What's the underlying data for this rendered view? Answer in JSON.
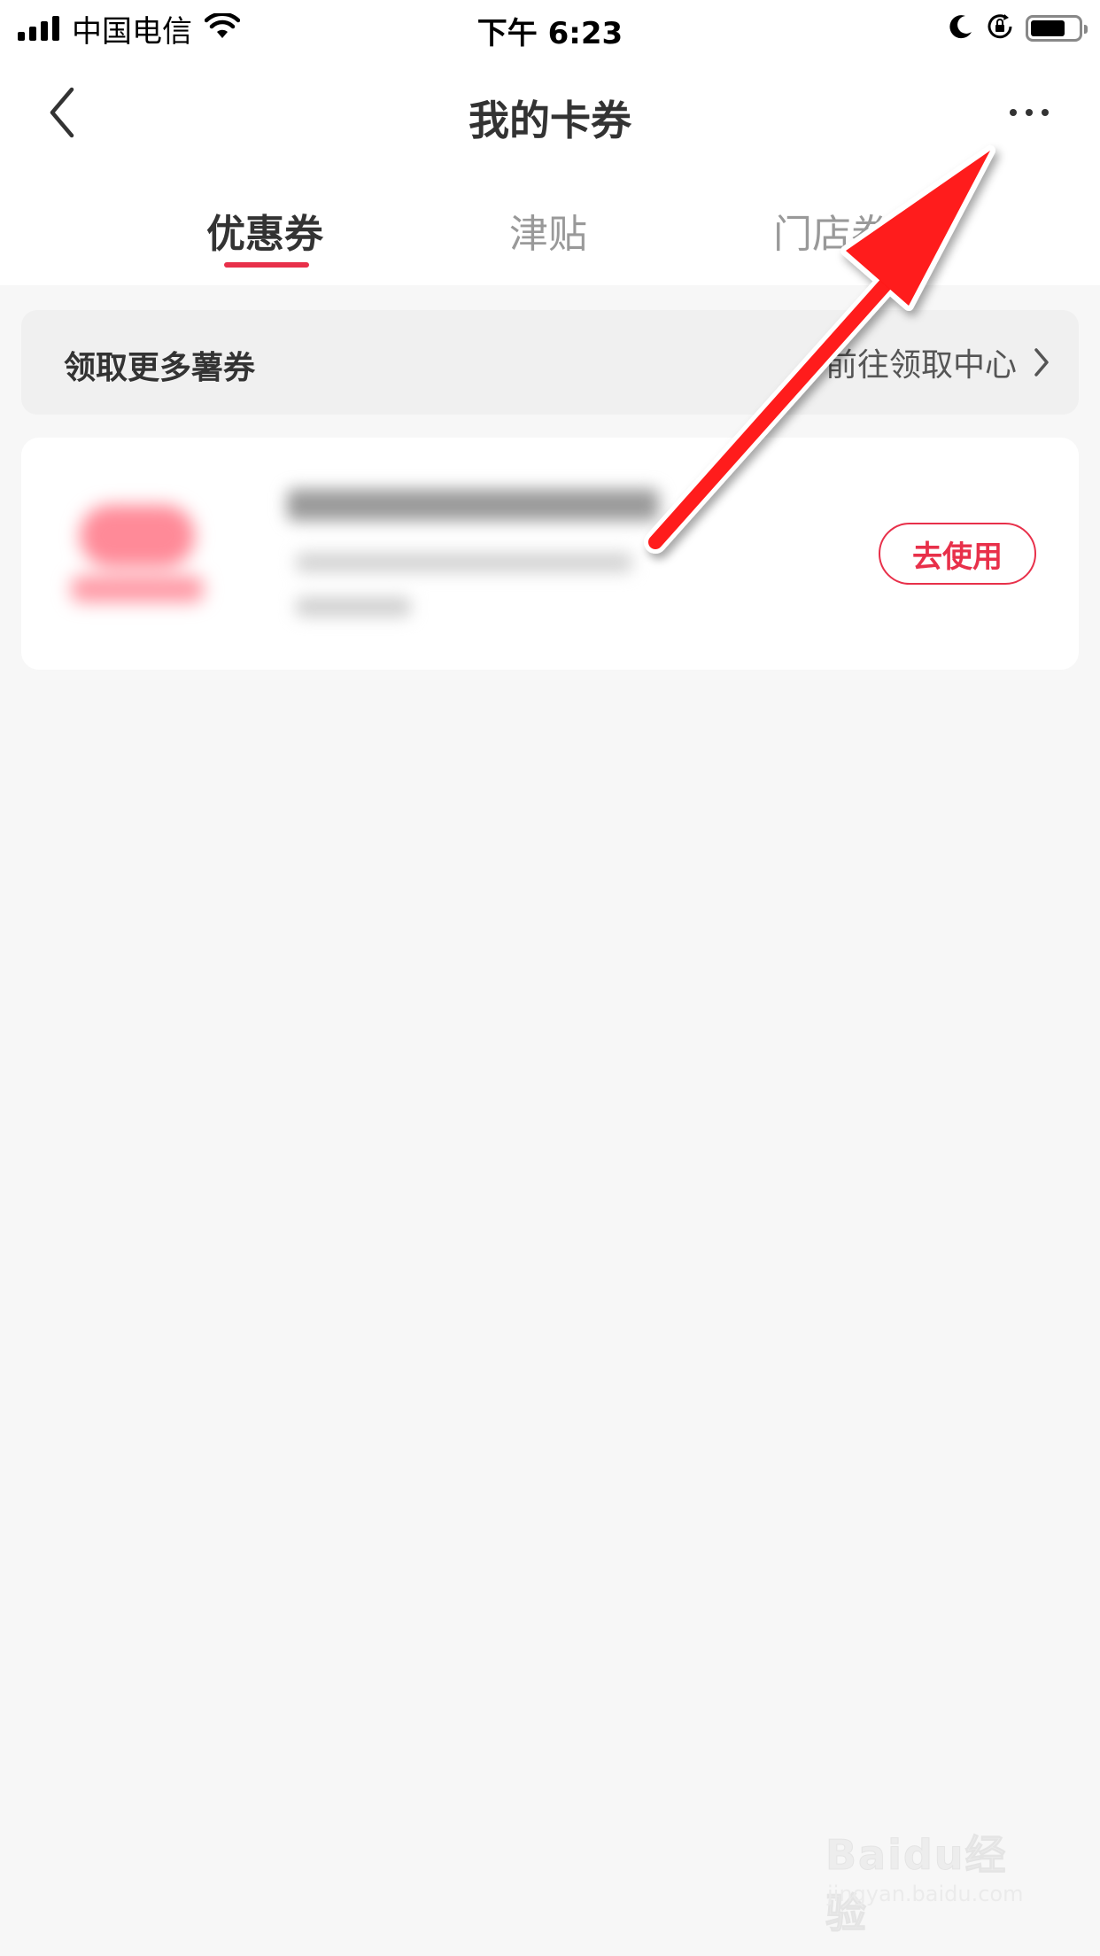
{
  "status_bar": {
    "carrier": "中国电信",
    "time": "下午 6:23",
    "battery_level": 0.74
  },
  "nav": {
    "title": "我的卡券"
  },
  "tabs": [
    {
      "label": "优惠券",
      "active": true
    },
    {
      "label": "津贴",
      "active": false
    },
    {
      "label": "门店券",
      "active": false
    }
  ],
  "claim_row": {
    "label": "领取更多薯券",
    "link_text": "前往领取中心"
  },
  "coupon": {
    "action_label": "去使用"
  },
  "colors": {
    "accent": "#e8304a",
    "arrow": "#ff1a1a",
    "background": "#f7f7f7"
  },
  "watermark": {
    "logo_text": "Baidu经验",
    "sub_text": "jingyan.baidu.com"
  }
}
